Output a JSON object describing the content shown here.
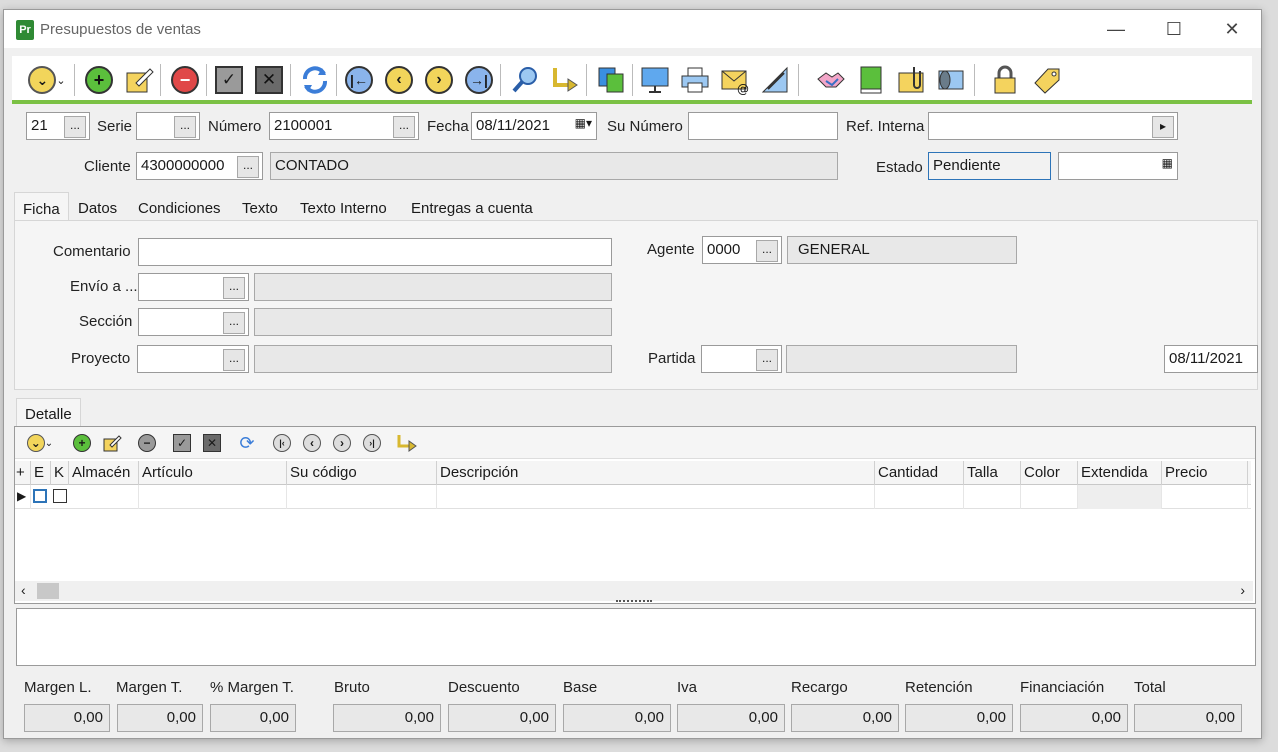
{
  "window": {
    "title": "Presupuestos de ventas",
    "icon_text": "Pr"
  },
  "header": {
    "code": "21",
    "serie_label": "Serie",
    "serie": "",
    "numero_label": "Número",
    "numero": "2100001",
    "fecha_label": "Fecha",
    "fecha": "08/11/2021",
    "su_numero_label": "Su Número",
    "su_numero": "",
    "ref_interna_label": "Ref. Interna",
    "ref_interna": "",
    "cliente_label": "Cliente",
    "cliente_code": "4300000000",
    "cliente_name": "CONTADO",
    "estado_label": "Estado",
    "estado": "Pendiente",
    "ellipsis": "..."
  },
  "tabs": [
    "Ficha",
    "Datos",
    "Condiciones",
    "Texto",
    "Texto Interno",
    "Entregas a cuenta"
  ],
  "ficha": {
    "comentario_label": "Comentario",
    "envio_label": "Envío a ...",
    "seccion_label": "Sección",
    "proyecto_label": "Proyecto",
    "agente_label": "Agente",
    "agente_code": "0000",
    "agente_name": "GENERAL",
    "partida_label": "Partida",
    "fecha": "08/11/2021"
  },
  "detalle": {
    "tab": "Detalle",
    "columns": [
      "+",
      "E",
      "K",
      "Almacén",
      "Artículo",
      "Su código",
      "Descripción",
      "Cantidad",
      "Talla",
      "Color",
      "Extendida",
      "Precio"
    ]
  },
  "footer": {
    "labels": [
      "Margen L.",
      "Margen T.",
      "% Margen T.",
      "Bruto",
      "Descuento",
      "Base",
      "Iva",
      "Recargo",
      "Retención",
      "Financiación",
      "Total"
    ],
    "values": [
      "0,00",
      "0,00",
      "0,00",
      "0,00",
      "0,00",
      "0,00",
      "0,00",
      "0,00",
      "0,00",
      "0,00",
      "0,00"
    ]
  },
  "colors": {
    "accent_green": "#7bc144",
    "focus_blue": "#2d74b8"
  }
}
